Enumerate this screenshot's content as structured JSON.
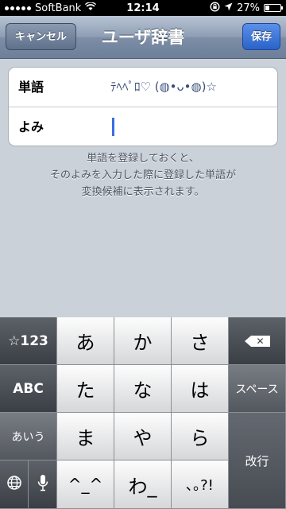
{
  "status_bar": {
    "carrier": "SoftBank",
    "time": "12:14",
    "battery": "27%",
    "battery_level": 0.27
  },
  "nav": {
    "title": "ユーザ辞書",
    "cancel_label": "キャンセル",
    "save_label": "保存"
  },
  "form": {
    "word_label": "単語",
    "word_value": "ﾃﾍﾍﾟﾛ♡ (◍•ᴗ•◍)☆",
    "reading_label": "よみ",
    "reading_value": ""
  },
  "help": {
    "line1": "単語を登録しておくと、",
    "line2": "そのよみを入力した際に登録した単語が",
    "line3": "変換候補に表示されます。"
  },
  "keyboard": {
    "numbers_key": "☆123",
    "abc_key": "ABC",
    "kana_key": "あいう",
    "globe_icon": "globe-icon",
    "mic_icon": "microphone-icon",
    "keys": [
      "あ",
      "か",
      "さ",
      "た",
      "な",
      "は",
      "ま",
      "や",
      "ら",
      "^_^",
      "わ_",
      "､｡?!"
    ],
    "backspace_icon": "backspace-icon",
    "space_key": "スペース",
    "return_key": "改行"
  }
}
